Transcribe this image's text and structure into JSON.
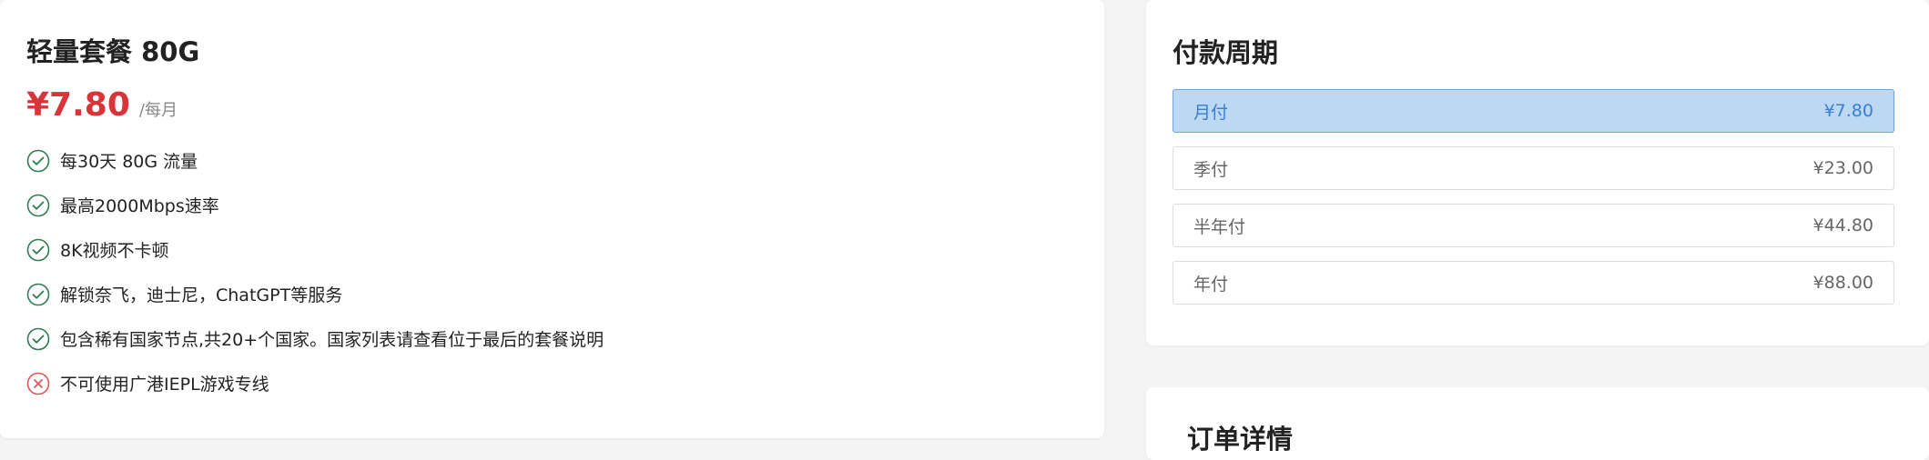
{
  "plan": {
    "title": "轻量套餐 80G",
    "price": "¥7.80",
    "price_unit": "/每月",
    "features": [
      {
        "text": "每30天 80G 流量",
        "included": true,
        "icon": "check-circle-icon"
      },
      {
        "text": "最高2000Mbps速率",
        "included": true,
        "icon": "check-circle-icon"
      },
      {
        "text": "8K视频不卡顿",
        "included": true,
        "icon": "check-circle-icon"
      },
      {
        "text": "解锁奈飞，迪士尼，ChatGPT等服务",
        "included": true,
        "icon": "check-circle-icon"
      },
      {
        "text": "包含稀有国家节点,共20+个国家。国家列表请查看位于最后的套餐说明",
        "included": true,
        "icon": "check-circle-icon"
      },
      {
        "text": "不可使用广港IEPL游戏专线",
        "included": false,
        "icon": "x-circle-icon"
      }
    ]
  },
  "payment_period": {
    "title": "付款周期",
    "options": [
      {
        "label": "月付",
        "price": "¥7.80",
        "selected": true
      },
      {
        "label": "季付",
        "price": "¥23.00",
        "selected": false
      },
      {
        "label": "半年付",
        "price": "¥44.80",
        "selected": false
      },
      {
        "label": "年付",
        "price": "¥88.00",
        "selected": false
      }
    ]
  },
  "order_details": {
    "title": "订单详情"
  },
  "colors": {
    "price": "#d8343a",
    "check": "#2e7d4f",
    "cross": "#e05555",
    "selected_bg": "#bcd8f2",
    "selected_text": "#3a7fcf"
  }
}
